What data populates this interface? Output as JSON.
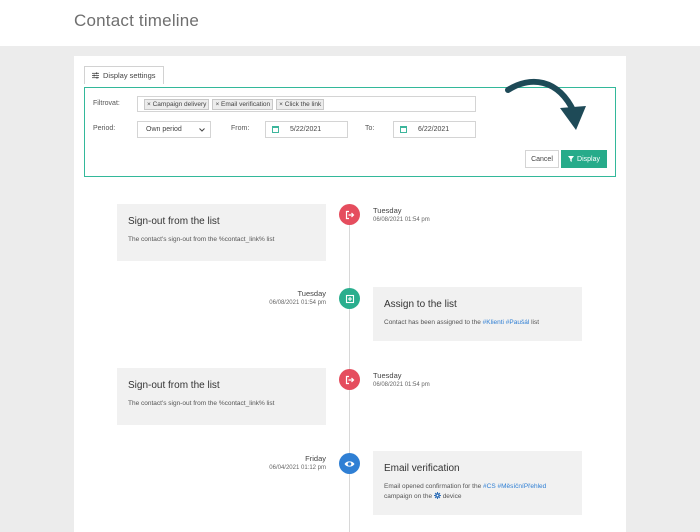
{
  "header": {
    "title": "Contact timeline"
  },
  "settings_tab": {
    "label": "Display settings",
    "icon": "sliders-icon"
  },
  "filter": {
    "filter_label": "Filtrovat:",
    "tags": [
      "× Campaign delivery",
      "× Email verification",
      "× Click the link"
    ],
    "period_label": "Period:",
    "period_value": "Own period",
    "from_label": "From:",
    "from_value": "5/22/2021",
    "to_label": "To:",
    "to_value": "6/22/2021",
    "cancel_label": "Cancel",
    "display_label": "Display"
  },
  "colors": {
    "accent": "#27ab8a",
    "signout": "#e54d5e",
    "assign": "#2aae8e",
    "email": "#2f7fd4",
    "link": "#2f7fd4"
  },
  "events": [
    {
      "title": "Sign-out from the list",
      "desc": "The contact's sign-out from the %contact_link% list",
      "day": "Tuesday",
      "time": "06/08/2021 01:54 pm",
      "icon": "sign-out-icon"
    },
    {
      "title": "Assign to the list",
      "desc_prefix": "Contact has been assigned to the",
      "desc_links": "#Klienti #Paušál",
      "desc_suffix": "list",
      "day": "Tuesday",
      "time": "06/08/2021 01:54 pm",
      "icon": "add-square-icon"
    },
    {
      "title": "Sign-out from the list",
      "desc": "The contact's sign-out from the %contact_link% list",
      "day": "Tuesday",
      "time": "06/08/2021 01:54 pm",
      "icon": "sign-out-icon"
    },
    {
      "title": "Email verification",
      "desc_prefix": "Email opened confirmation for the",
      "desc_links": "#CS #MěsíčníPřehled",
      "desc_line2_prefix": "campaign on the",
      "desc_line2_suffix": "device",
      "day": "Friday",
      "time": "06/04/2021 01:12 pm",
      "icon": "eye-icon"
    }
  ]
}
